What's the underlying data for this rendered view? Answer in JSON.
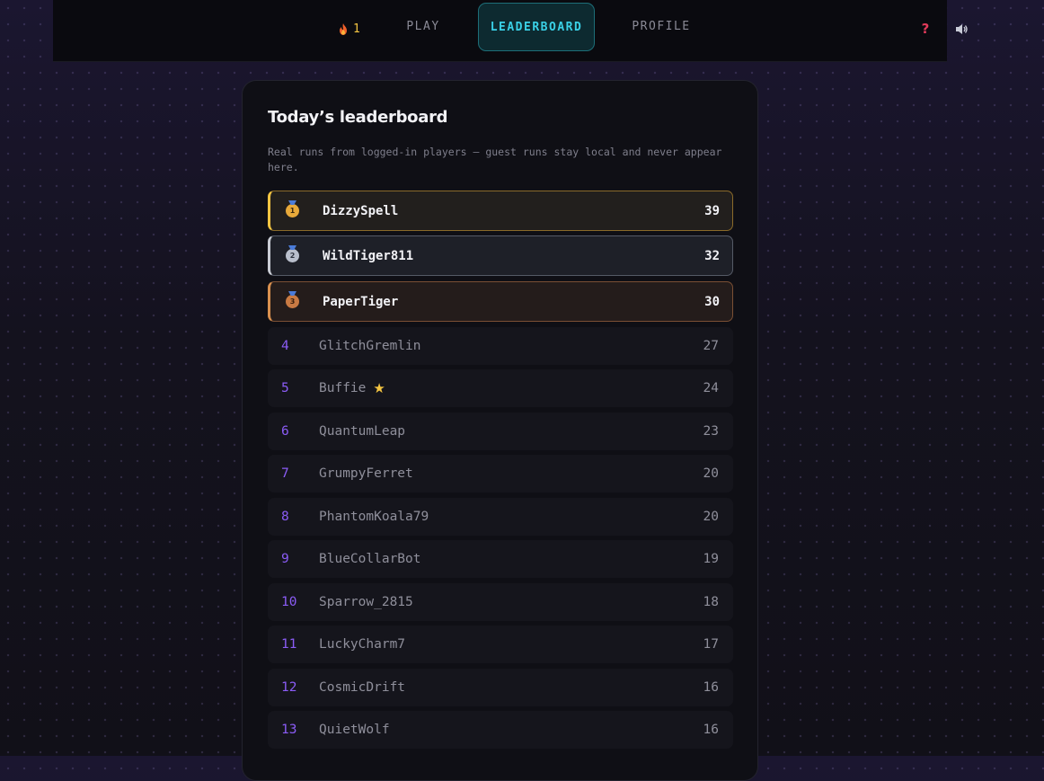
{
  "topbar": {
    "streak_count": "1",
    "tabs": [
      {
        "label": "PLAY"
      },
      {
        "label": "LEADERBOARD",
        "active": true
      },
      {
        "label": "PROFILE"
      }
    ],
    "help_symbol": "?",
    "icons": {
      "streak": "flame-icon",
      "help": "help-icon",
      "sound": "speaker-icon"
    }
  },
  "leaderboard": {
    "title": "Today’s leaderboard",
    "subtitle": "Real runs from logged-in players — guest runs stay local and never appear here.",
    "top3": [
      {
        "medal": "gold-medal-icon",
        "medal_num": "1",
        "name": "DizzySpell",
        "score": "39"
      },
      {
        "medal": "silver-medal-icon",
        "medal_num": "2",
        "name": "WildTiger811",
        "score": "32"
      },
      {
        "medal": "bronze-medal-icon",
        "medal_num": "3",
        "name": "PaperTiger",
        "score": "30"
      }
    ],
    "rows": [
      {
        "rank": "4",
        "name": "GlitchGremlin",
        "score": "27"
      },
      {
        "rank": "5",
        "name": "Buffie",
        "badge": "★",
        "score": "24"
      },
      {
        "rank": "6",
        "name": "QuantumLeap",
        "score": "23"
      },
      {
        "rank": "7",
        "name": "GrumpyFerret",
        "score": "20"
      },
      {
        "rank": "8",
        "name": "PhantomKoala79",
        "score": "20"
      },
      {
        "rank": "9",
        "name": "BlueCollarBot",
        "score": "19"
      },
      {
        "rank": "10",
        "name": "Sparrow_2815",
        "score": "18"
      },
      {
        "rank": "11",
        "name": "LuckyCharm7",
        "score": "17"
      },
      {
        "rank": "12",
        "name": "CosmicDrift",
        "score": "16"
      },
      {
        "rank": "13",
        "name": "QuietWolf",
        "score": "16"
      }
    ]
  },
  "colors": {
    "accent_cyan": "#3ad0e6",
    "rank_purple": "#8b5cf6",
    "gold": "#f4c542",
    "silver": "#c9ccd4",
    "bronze": "#d9904f"
  }
}
